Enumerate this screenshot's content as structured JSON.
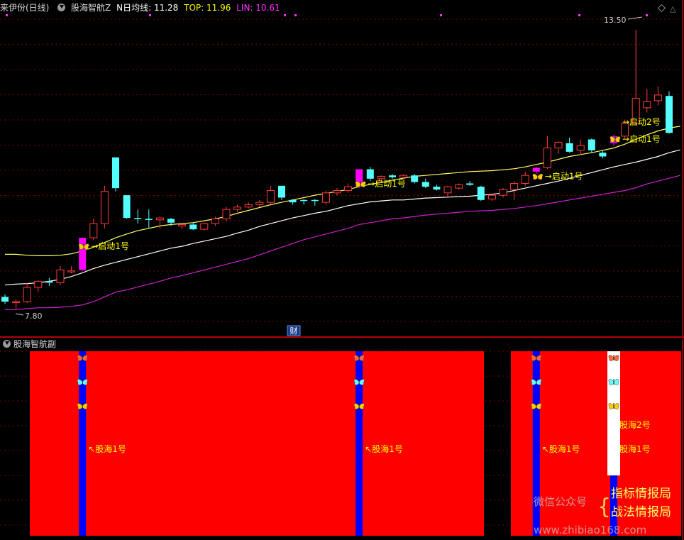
{
  "header": {
    "stock_name": "来伊份(日线)",
    "indicator_name": "股海智航Z",
    "ma_label": "N日均线:",
    "ma_value": "11.28",
    "top_label": "TOP:",
    "top_value": "11.96",
    "lin_label": "LIN:",
    "lin_value": "10.61"
  },
  "sub_panel": {
    "title": "股海智航副"
  },
  "colors": {
    "up": "#ff3b3b",
    "down": "#54ffff",
    "signal_bar": "#ff00ff",
    "ma_line": "#ffff66",
    "lower_white": "#ffffff",
    "lin_line": "#cc22cc",
    "panel_red": "#ff0000",
    "panel_blue": "#0000ff",
    "ann_text": "#ffff00",
    "grid": "#7a0000"
  },
  "chart_data": {
    "type": "candlestick",
    "y_range": [
      7.5,
      14.0
    ],
    "candles": [
      {
        "o": 8.05,
        "h": 8.1,
        "l": 7.9,
        "c": 7.95,
        "dir": "down"
      },
      {
        "o": 7.95,
        "h": 8.0,
        "l": 7.8,
        "c": 7.95,
        "dir": "up"
      },
      {
        "o": 7.95,
        "h": 8.35,
        "l": 7.92,
        "c": 8.25,
        "dir": "up"
      },
      {
        "o": 8.25,
        "h": 8.4,
        "l": 8.15,
        "c": 8.38,
        "dir": "up"
      },
      {
        "o": 8.38,
        "h": 8.45,
        "l": 8.28,
        "c": 8.35,
        "dir": "down"
      },
      {
        "o": 8.35,
        "h": 8.7,
        "l": 8.3,
        "c": 8.62,
        "dir": "up"
      },
      {
        "o": 8.6,
        "h": 8.7,
        "l": 8.55,
        "c": 8.6,
        "dir": "up"
      },
      {
        "o": 8.62,
        "h": 9.3,
        "l": 8.6,
        "c": 9.3,
        "dir": "signal"
      },
      {
        "o": 9.3,
        "h": 9.7,
        "l": 9.25,
        "c": 9.6,
        "dir": "up"
      },
      {
        "o": 9.6,
        "h": 10.4,
        "l": 9.5,
        "c": 10.28,
        "dir": "up"
      },
      {
        "o": 11.0,
        "h": 11.0,
        "l": 10.28,
        "c": 10.35,
        "dir": "down"
      },
      {
        "o": 10.2,
        "h": 10.2,
        "l": 9.7,
        "c": 9.72,
        "dir": "down"
      },
      {
        "o": 9.72,
        "h": 9.9,
        "l": 9.6,
        "c": 9.72,
        "dir": "down"
      },
      {
        "o": 9.7,
        "h": 9.9,
        "l": 9.5,
        "c": 9.68,
        "dir": "down"
      },
      {
        "o": 9.68,
        "h": 9.75,
        "l": 9.5,
        "c": 9.72,
        "dir": "up"
      },
      {
        "o": 9.7,
        "h": 9.72,
        "l": 9.55,
        "c": 9.62,
        "dir": "down"
      },
      {
        "o": 9.55,
        "h": 9.62,
        "l": 9.48,
        "c": 9.58,
        "dir": "up"
      },
      {
        "o": 9.58,
        "h": 9.62,
        "l": 9.46,
        "c": 9.48,
        "dir": "down"
      },
      {
        "o": 9.48,
        "h": 9.62,
        "l": 9.45,
        "c": 9.6,
        "dir": "up"
      },
      {
        "o": 9.6,
        "h": 9.75,
        "l": 9.55,
        "c": 9.7,
        "dir": "up"
      },
      {
        "o": 9.7,
        "h": 9.95,
        "l": 9.65,
        "c": 9.9,
        "dir": "up"
      },
      {
        "o": 9.9,
        "h": 10.0,
        "l": 9.85,
        "c": 9.95,
        "dir": "up"
      },
      {
        "o": 9.95,
        "h": 10.05,
        "l": 9.92,
        "c": 10.0,
        "dir": "up"
      },
      {
        "o": 10.0,
        "h": 10.1,
        "l": 9.95,
        "c": 10.05,
        "dir": "up"
      },
      {
        "o": 10.05,
        "h": 10.4,
        "l": 10.0,
        "c": 10.3,
        "dir": "up"
      },
      {
        "o": 10.4,
        "h": 10.4,
        "l": 10.1,
        "c": 10.15,
        "dir": "down"
      },
      {
        "o": 10.1,
        "h": 10.12,
        "l": 10.0,
        "c": 10.05,
        "dir": "down"
      },
      {
        "o": 10.1,
        "h": 10.12,
        "l": 10.0,
        "c": 10.08,
        "dir": "down"
      },
      {
        "o": 10.1,
        "h": 10.12,
        "l": 9.98,
        "c": 10.08,
        "dir": "down"
      },
      {
        "o": 10.05,
        "h": 10.3,
        "l": 10.0,
        "c": 10.25,
        "dir": "up"
      },
      {
        "o": 10.25,
        "h": 10.35,
        "l": 10.2,
        "c": 10.3,
        "dir": "up"
      },
      {
        "o": 10.3,
        "h": 10.45,
        "l": 10.25,
        "c": 10.38,
        "dir": "up"
      },
      {
        "o": 10.38,
        "h": 10.75,
        "l": 10.35,
        "c": 10.75,
        "dir": "signal"
      },
      {
        "o": 10.75,
        "h": 10.8,
        "l": 10.5,
        "c": 10.55,
        "dir": "down"
      },
      {
        "o": 10.55,
        "h": 10.62,
        "l": 10.48,
        "c": 10.6,
        "dir": "up"
      },
      {
        "o": 10.62,
        "h": 10.65,
        "l": 10.55,
        "c": 10.58,
        "dir": "down"
      },
      {
        "o": 10.58,
        "h": 10.65,
        "l": 10.55,
        "c": 10.62,
        "dir": "up"
      },
      {
        "o": 10.62,
        "h": 10.65,
        "l": 10.45,
        "c": 10.48,
        "dir": "down"
      },
      {
        "o": 10.48,
        "h": 10.55,
        "l": 10.35,
        "c": 10.38,
        "dir": "down"
      },
      {
        "o": 10.38,
        "h": 10.42,
        "l": 10.3,
        "c": 10.32,
        "dir": "down"
      },
      {
        "o": 10.25,
        "h": 10.4,
        "l": 10.18,
        "c": 10.38,
        "dir": "up"
      },
      {
        "o": 10.35,
        "h": 10.45,
        "l": 10.32,
        "c": 10.42,
        "dir": "up"
      },
      {
        "o": 10.45,
        "h": 10.5,
        "l": 10.4,
        "c": 10.42,
        "dir": "down"
      },
      {
        "o": 10.38,
        "h": 10.4,
        "l": 10.08,
        "c": 10.1,
        "dir": "down"
      },
      {
        "o": 10.12,
        "h": 10.22,
        "l": 10.08,
        "c": 10.2,
        "dir": "up"
      },
      {
        "o": 10.2,
        "h": 10.35,
        "l": 10.15,
        "c": 10.32,
        "dir": "up"
      },
      {
        "o": 10.32,
        "h": 10.5,
        "l": 10.1,
        "c": 10.45,
        "dir": "up"
      },
      {
        "o": 10.45,
        "h": 10.7,
        "l": 10.4,
        "c": 10.62,
        "dir": "up"
      },
      {
        "o": 10.7,
        "h": 10.8,
        "l": 10.65,
        "c": 10.78,
        "dir": "signal"
      },
      {
        "o": 10.78,
        "h": 11.45,
        "l": 10.75,
        "c": 11.2,
        "dir": "up"
      },
      {
        "o": 11.2,
        "h": 11.35,
        "l": 11.08,
        "c": 11.32,
        "dir": "up"
      },
      {
        "o": 11.3,
        "h": 11.42,
        "l": 11.1,
        "c": 11.12,
        "dir": "down"
      },
      {
        "o": 11.15,
        "h": 11.38,
        "l": 11.05,
        "c": 11.25,
        "dir": "up"
      },
      {
        "o": 11.38,
        "h": 11.4,
        "l": 11.1,
        "c": 11.15,
        "dir": "down"
      },
      {
        "o": 11.1,
        "h": 11.15,
        "l": 10.98,
        "c": 11.02,
        "dir": "down"
      },
      {
        "o": 11.3,
        "h": 11.48,
        "l": 11.25,
        "c": 11.45,
        "dir": "signal"
      },
      {
        "o": 11.45,
        "h": 11.8,
        "l": 11.4,
        "c": 11.72,
        "dir": "up"
      },
      {
        "o": 11.72,
        "h": 13.7,
        "l": 11.7,
        "c": 12.25,
        "dir": "up"
      },
      {
        "o": 12.05,
        "h": 12.45,
        "l": 11.95,
        "c": 12.18,
        "dir": "up"
      },
      {
        "o": 12.2,
        "h": 12.5,
        "l": 12.1,
        "c": 12.32,
        "dir": "up"
      },
      {
        "o": 12.3,
        "h": 12.4,
        "l": 11.5,
        "c": 11.52,
        "dir": "down"
      }
    ],
    "lines": {
      "ma_yellow": [
        8.95,
        8.95,
        8.93,
        8.92,
        8.92,
        8.93,
        8.96,
        9.02,
        9.1,
        9.2,
        9.3,
        9.38,
        9.45,
        9.5,
        9.55,
        9.58,
        9.6,
        9.62,
        9.66,
        9.7,
        9.75,
        9.82,
        9.88,
        9.94,
        10.0,
        10.05,
        10.1,
        10.15,
        10.2,
        10.24,
        10.28,
        10.32,
        10.38,
        10.43,
        10.47,
        10.52,
        10.56,
        10.6,
        10.62,
        10.64,
        10.66,
        10.68,
        10.7,
        10.71,
        10.72,
        10.74,
        10.76,
        10.8,
        10.85,
        10.9,
        10.96,
        11.02,
        11.06,
        11.1,
        11.15,
        11.2,
        11.28,
        11.38,
        11.48,
        11.56,
        11.62,
        11.66
      ],
      "lower_white": [
        8.3,
        8.32,
        8.33,
        8.35,
        8.38,
        8.42,
        8.48,
        8.56,
        8.65,
        8.72,
        8.78,
        8.84,
        8.9,
        8.96,
        9.02,
        9.08,
        9.12,
        9.18,
        9.23,
        9.28,
        9.33,
        9.4,
        9.46,
        9.54,
        9.6,
        9.66,
        9.72,
        9.77,
        9.82,
        9.86,
        9.92,
        9.98,
        10.02,
        10.06,
        10.08,
        10.1,
        10.1,
        10.12,
        10.14,
        10.15,
        10.16,
        10.17,
        10.18,
        10.2,
        10.22,
        10.25,
        10.3,
        10.35,
        10.4,
        10.45,
        10.5,
        10.56,
        10.62,
        10.68,
        10.74,
        10.8,
        10.85,
        10.9,
        10.96,
        11.02,
        11.1,
        11.16
      ],
      "lin_magenta": [
        7.78,
        7.78,
        7.8,
        7.82,
        7.82,
        7.83,
        7.85,
        7.88,
        7.95,
        8.05,
        8.15,
        8.2,
        8.26,
        8.32,
        8.38,
        8.45,
        8.5,
        8.56,
        8.62,
        8.68,
        8.74,
        8.8,
        8.86,
        8.94,
        9.02,
        9.1,
        9.18,
        9.26,
        9.32,
        9.38,
        9.44,
        9.5,
        9.58,
        9.62,
        9.66,
        9.7,
        9.72,
        9.75,
        9.78,
        9.8,
        9.82,
        9.84,
        9.86,
        9.87,
        9.88,
        9.9,
        9.92,
        9.95,
        9.98,
        10.02,
        10.06,
        10.1,
        10.14,
        10.18,
        10.22,
        10.26,
        10.3,
        10.36,
        10.44,
        10.5,
        10.56,
        10.62
      ]
    },
    "price_labels": {
      "high": "13.50",
      "low": "7.80"
    },
    "annotations": [
      "→启动1号",
      "→启动1号",
      "→启动1号",
      "→启动1号",
      "→启动2号"
    ],
    "sub_labels": [
      "股海1号",
      "股海1号",
      "股海1号",
      "股海2号",
      "股海1号"
    ],
    "marker_text": "财",
    "watermark": {
      "left": "微信公众号",
      "brace": "{",
      "line1": "指标情报局",
      "line2": "战法情报局",
      "site": "www.zhibiao168.com"
    }
  }
}
